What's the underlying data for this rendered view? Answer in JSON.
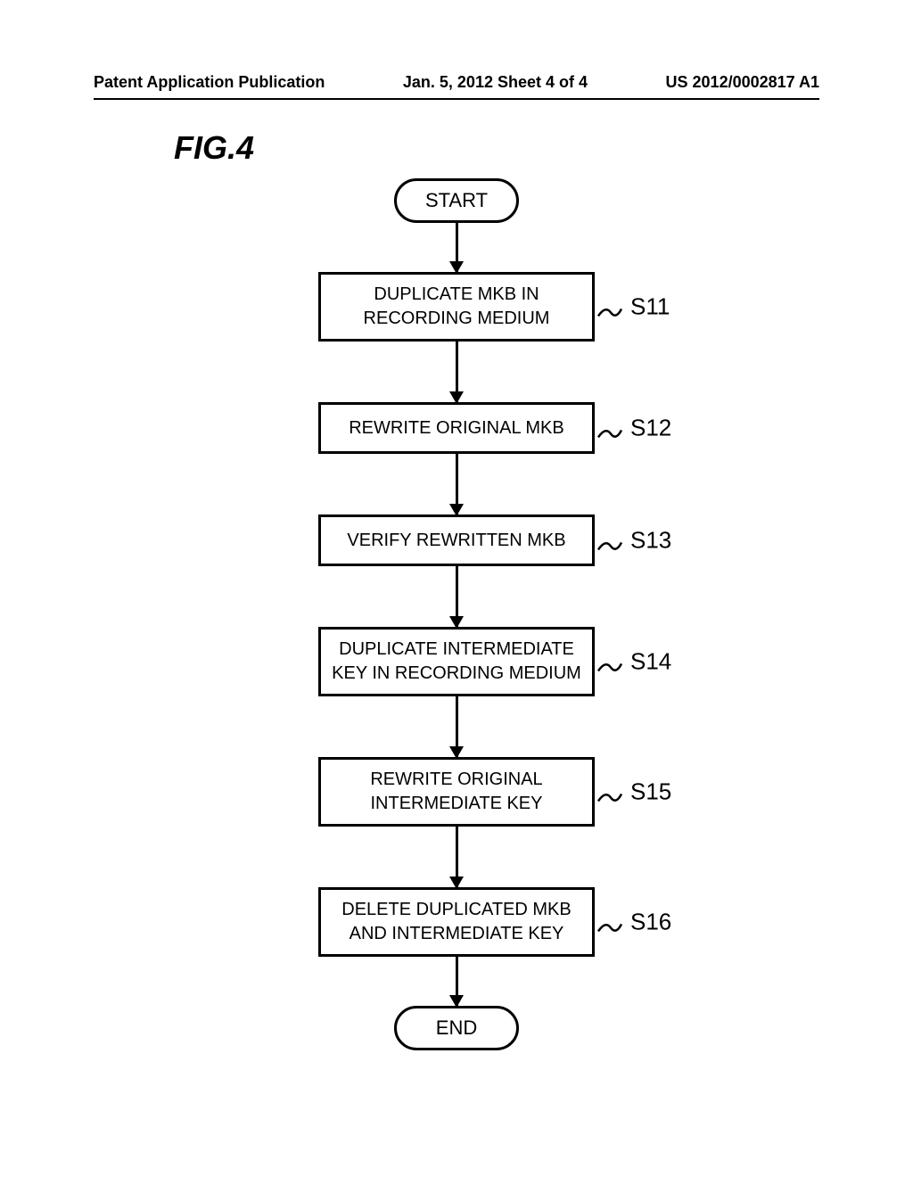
{
  "header": {
    "left": "Patent Application Publication",
    "center": "Jan. 5, 2012  Sheet 4 of 4",
    "right": "US 2012/0002817 A1"
  },
  "figure_label": "FIG.4",
  "flowchart": {
    "start": "START",
    "end": "END",
    "steps": [
      {
        "id": "S11",
        "text": "DUPLICATE MKB IN RECORDING MEDIUM",
        "lines": 2
      },
      {
        "id": "S12",
        "text": "REWRITE ORIGINAL MKB",
        "lines": 1
      },
      {
        "id": "S13",
        "text": "VERIFY REWRITTEN MKB",
        "lines": 1
      },
      {
        "id": "S14",
        "text": "DUPLICATE INTERMEDIATE KEY IN RECORDING MEDIUM",
        "lines": 2
      },
      {
        "id": "S15",
        "text": "REWRITE ORIGINAL INTERMEDIATE KEY",
        "lines": 2
      },
      {
        "id": "S16",
        "text": "DELETE DUPLICATED MKB AND INTERMEDIATE KEY",
        "lines": 2
      }
    ]
  }
}
